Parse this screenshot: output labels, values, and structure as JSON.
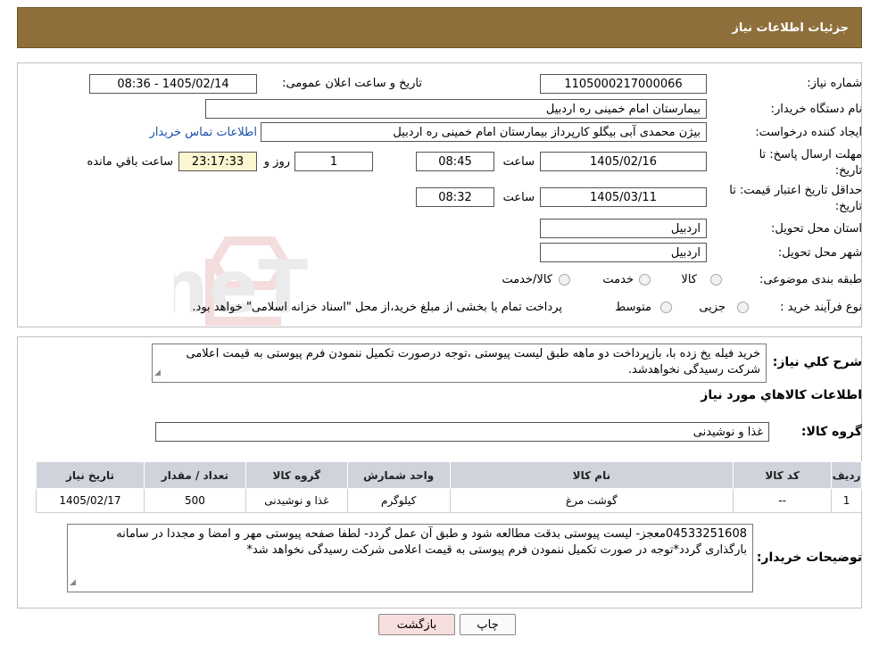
{
  "header": {
    "title": "جزئیات اطلاعات نیاز"
  },
  "form": {
    "need_number_label": "شماره نیاز:",
    "need_number": "1105000217000066",
    "announce_label": "تاریخ و ساعت اعلان عمومی:",
    "announce_value": "1405/02/14 - 08:36",
    "buyer_org_label": "نام دستگاه خریدار:",
    "buyer_org": "بیمارستان امام خمینی  ره  اردبیل",
    "creator_label": "ایجاد کننده درخواست:",
    "creator": "بیژن محمدی آبی بیگلو کارپرداز بیمارستان امام خمینی  ره  اردبیل",
    "contact_link": "اطلاعات تماس خریدار",
    "deadline_label_1": "مهلت ارسال پاسخ: تا",
    "deadline_label_2": "تاریخ:",
    "deadline_date": "1405/02/16",
    "time_label": "ساعت",
    "deadline_time": "08:45",
    "days_value": "1",
    "days_label": "روز و",
    "remaining_time": "23:17:33",
    "remaining_label": "ساعت باقي مانده",
    "validity_label_1": "حداقل تاریخ اعتبار قیمت: تا",
    "validity_label_2": "تاریخ:",
    "validity_date": "1405/03/11",
    "validity_time": "08:32",
    "province_label": "استان محل تحویل:",
    "province": "اردبیل",
    "city_label": "شهر محل تحویل:",
    "city": "اردبیل",
    "category_label": "طبقه بندی موضوعی:",
    "category_options": [
      "کالا",
      "خدمت",
      "کالا/خدمت"
    ],
    "process_label": "نوع فرآیند خرید :",
    "process_options": [
      "جزیی",
      "متوسط"
    ],
    "process_note": "پرداخت تمام یا بخشی از مبلغ خرید،از محل \"اسناد خزانه اسلامی\" خواهد بود."
  },
  "watermark": "AriaTender.neT",
  "details": {
    "summary_label": "شرح کلي نیاز:",
    "summary_text": "خرید فیله یخ زده با، بازپرداخت دو ماهه طبق لیست پیوستی ،توجه درصورت تکمیل ننمودن فرم پیوستی به قیمت اعلامی شرکت رسیدگی نخواهدشد.",
    "goods_info_title": "اطلاعات کالاهاي مورد نیاز",
    "goods_group_label": "گروه کالا:",
    "goods_group": "غذا و نوشیدنی"
  },
  "table": {
    "headers": [
      "ردیف",
      "کد کالا",
      "نام کالا",
      "واحد شمارش",
      "گروه کالا",
      "تعداد / مقدار",
      "تاریخ نیاز"
    ],
    "rows": [
      [
        "1",
        "--",
        "گوشت مرغ",
        "کیلوگرم",
        "غذا و نوشیدنی",
        "500",
        "1405/02/17"
      ]
    ]
  },
  "buyer_notes": {
    "label": "توضیحات خریدار:",
    "text": "04533251608معجز- لیست پیوستی بدقت مطالعه شود و طبق آن عمل گردد- لطفا صفحه پیوستی مهر و امضا و مجددا در سامانه بارگذاری گردد*توجه در صورت تکمیل ننمودن فرم پیوستی به قیمت اعلامی شرکت رسیدگی نخواهد شد*"
  },
  "buttons": {
    "print": "چاپ",
    "back": "بازگشت"
  },
  "colors": {
    "header_bg": "#8e6f3b",
    "table_header_bg": "#cfd4dc",
    "back_btn_bg": "#f7dede",
    "remaining_bg": "#fbf5d0",
    "link": "#1a4fa8"
  }
}
